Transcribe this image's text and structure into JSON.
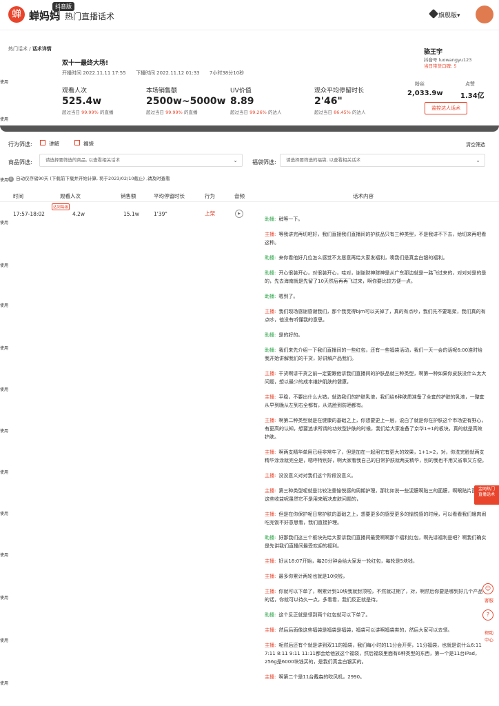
{
  "header": {
    "logo_char": "蝉",
    "brand": "蝉妈妈",
    "beta": "抖音版",
    "subtitle": "热门直播话术",
    "vip": "旗舰版",
    "vip_caret": "▾"
  },
  "breadcrumb": {
    "parent": "热门话术",
    "sep": " / ",
    "current": "话术详情"
  },
  "live": {
    "title": "双十一最终大场!",
    "start": "开播时间 2022.11.11 17:55",
    "end": "下播时间 2022.11.12 01:33",
    "duration": "7小时38分10秒"
  },
  "side_label": "使用",
  "stats": [
    {
      "label": "观看人次",
      "value": "525.4w",
      "sub_pre": "超过当日",
      "sub_pct": "99.99%",
      "sub_post": "的直播"
    },
    {
      "label": "本场销售额",
      "value": "2500w~5000w",
      "sub_pre": "超过当日",
      "sub_pct": "99.99%",
      "sub_post": "的直播"
    },
    {
      "label": "UV价值",
      "value": "8.89",
      "sub_pre": "超过当日",
      "sub_pct": "99.26%",
      "sub_post": "的达人"
    },
    {
      "label": "观众平均停留时长",
      "value": "2'46\"",
      "sub_pre": "超过当日",
      "sub_pct": "86.45%",
      "sub_post": "的达人"
    }
  ],
  "host": {
    "name": "骆王宇",
    "id": "抖音号 luowangyu123",
    "rank": "当日带货口碑: 5",
    "fans_label": "粉丝",
    "fans_value": "2,033.9w",
    "likes_label": "点赞",
    "likes_value": "1.34亿",
    "track_label": "监控达人话术"
  },
  "filters": {
    "behavior_label": "行为筛选:",
    "opt1": "讲解",
    "opt2": "福袋",
    "clear": "清空筛选",
    "product_label": "商品筛选:",
    "product_placeholder": "请选择要筛选的商品, 以查看相关话术",
    "bag_label": "福袋筛选:",
    "bag_placeholder": "请选择要筛选的福袋, 以查看相关话术",
    "info_icon": "i",
    "info": "自动仅存储90天 (下载前下载并开始计算, 将于2023/02/10截止) ,",
    "info_link": "请及时查看"
  },
  "table": {
    "headers": [
      "时间",
      "观看人次",
      "销售额",
      "平均停留时长",
      "行为",
      "音频",
      "话术内容"
    ],
    "row": {
      "time": "17:57-18:02",
      "peak": "达到每级",
      "views": "4.2w",
      "sales": "15.1w",
      "stay": "1'39\"",
      "action": "上架",
      "play_icon": "▶"
    }
  },
  "script": [
    {
      "role": "助播:",
      "type": "zhu",
      "text": "稍等一下。"
    },
    {
      "role": "主播:",
      "type": "zb",
      "text": "等我讲完再切吧好，我们直接我们直播间的护肤品只有三种类型，不是我讲不下去，给切来再吧看这种。"
    },
    {
      "role": "助播:",
      "type": "zhu",
      "text": "来你看他好几位怎么感觉不太愿意再给大家发福利，噢我们是真金白银的福利。"
    },
    {
      "role": "助播:",
      "type": "zhu",
      "text": "开心很装开心，对很装开心，哇对，谢谢财神财神是从广东那边就是一路飞过来的，对对对是的是的，先去海南就是先留了10天然后再再飞过来，啊你要比较方便一点。"
    },
    {
      "role": "助播:",
      "type": "zhu",
      "text": "嗯到了。"
    },
    {
      "role": "主播:",
      "type": "zb",
      "text": "我们现场感谢感谢我们，那个我觉得bjm可以关掉了，真的有点吵，我们先不要笔架，我们真的有点吵，他没有听懂我的意思。"
    },
    {
      "role": "助播:",
      "type": "zhu",
      "text": "是的好的。"
    },
    {
      "role": "助播:",
      "type": "zhu",
      "text": "我们来先介绍一下我们直播间的一些红包，还有一些福袋活动，我们一天一会的话呢6:00准时给我开始讲解我们的干货，好讲解产品我们。"
    },
    {
      "role": "主播:",
      "type": "zb",
      "text": "干货啊讲干货之前一定要跟他讲我们直播间的护肤品就三种类型，啊第一种如果你皮肤没什么太大问题，想以最少的成本维护肌肤的健康，"
    },
    {
      "role": "主播:",
      "type": "zb",
      "text": "平稳，不要出什么大错，就选我们的护肤乳液，我们给6种肤质准备了全套的护肤的乳液，一整套从早到晚从左到右全都有，从洗脸到防晒都有。"
    },
    {
      "role": "主播:",
      "type": "zb",
      "text": "啊第二种类型就是在健康的基础之上，你想要更上一层，说白了就是你在护肤这个市场更有野心，有更高的认知，想要追求所谓的功效型护肤的时候，我们给大家准备了京华1+1的板块，真的就是高效护肤。"
    },
    {
      "role": "主播:",
      "type": "zb",
      "text": "啊两支精华单用已经非常牛了，但是加在一起用它有更大的效果，1+1>2，对，你洗完脸就两支精华涂涂就完全是，嗯呼特别好，啊大家看我自己的日常护肤就两支精华，别的我也不用又省事又方便。"
    },
    {
      "role": "主播:",
      "type": "zb",
      "text": "没没意义对对我们这个阶段没意义。"
    },
    {
      "role": "主播:",
      "type": "zb",
      "text": "第三种类型呢就是比较注重愉悦感的周期护理，那比如说一些泥膜啊贴三的面膜，啊眼贴片面膜，这些收益呢虽然它不是用来解决皮肤问题的，"
    },
    {
      "role": "主播:",
      "type": "zb",
      "text": "但是在你保护呢日常护肤的基础之上，想要更多的感受更多的愉悦感的时候，可以看看我们蛾肉闹吃完饭不好意思看，我们直接护理。"
    },
    {
      "role": "助播:",
      "type": "zhu",
      "text": "好那我们这三个板块先给大家讲我们直播间最受啊啊那个福利红包，啊先讲福利是吧？啊我们确实是先讲我们直播间最受欢迎的福利。"
    },
    {
      "role": "主播:",
      "type": "zb",
      "text": "好从18:07开始，每20分钟会给大家发一轮红包，每轮是5块钱，"
    },
    {
      "role": "主播:",
      "type": "zb",
      "text": "最多你累计两轮也就是10块钱，"
    },
    {
      "role": "主播:",
      "type": "zb",
      "text": "你就可以下单了，啊累计到10块我就封顶啦，不然就过期了，对，啊然后你要是哪到好几个产品的话，你就可以待久一点，多看看，我们反正就是待。"
    },
    {
      "role": "助播:",
      "type": "zhu",
      "text": "这个反正就是领到两个红包就可以下单了。"
    },
    {
      "role": "主播:",
      "type": "zb",
      "text": "然后后面像这些福袋是福袋是福袋，福袋可以讲啊福袋类的，然后大家可以去领。"
    },
    {
      "role": "主播:",
      "type": "zb",
      "text": "呃然后还有个就是讲到双11的福袋，我们每小时的11分会开奖，11分福袋，也就是说什么6:11 7:11 8:11 9:11 11:11都会给他放这个福袋，然后福袋里面有6种类型的东西，第一个是11台iPad，256g是6000块钱买的，是我们真金白银买的。"
    },
    {
      "role": "主播:",
      "type": "zb",
      "text": "啊第二个是11台戴森的吹风机，2990。"
    }
  ],
  "float": {
    "hot_line1": "金网热门",
    "hot_line2": "直播话术",
    "service_icon": "☺",
    "service_label": "客服",
    "help_icon": "?",
    "help_line1": "帮助",
    "help_line2": "中心"
  },
  "colors": {
    "accent": "#e8452c",
    "assistant": "#2fa64a"
  }
}
